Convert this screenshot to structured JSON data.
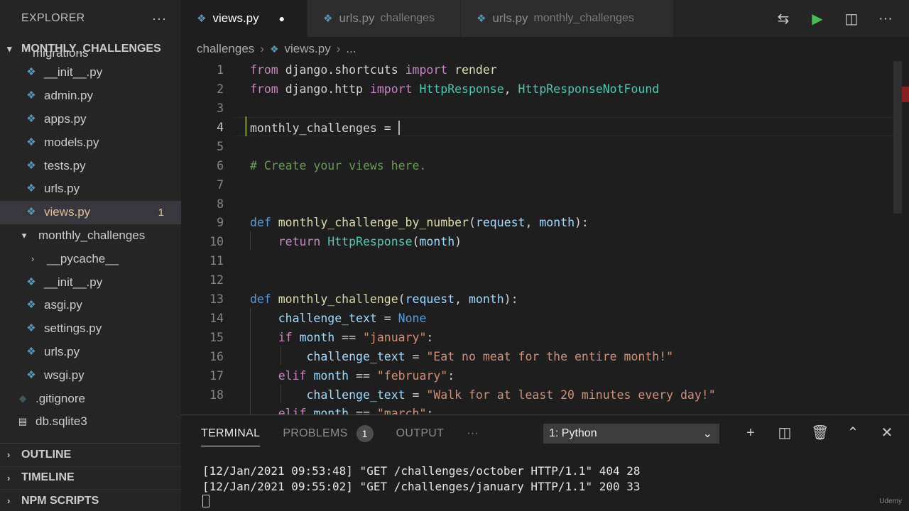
{
  "sidebar": {
    "title": "EXPLORER",
    "more": "···",
    "root": "MONTHLY_CHALLENGES",
    "items": [
      {
        "label": "migrations",
        "kind": "folder-partial"
      },
      {
        "label": "__init__.py",
        "kind": "py"
      },
      {
        "label": "admin.py",
        "kind": "py"
      },
      {
        "label": "apps.py",
        "kind": "py"
      },
      {
        "label": "models.py",
        "kind": "py"
      },
      {
        "label": "tests.py",
        "kind": "py"
      },
      {
        "label": "urls.py",
        "kind": "py"
      },
      {
        "label": "views.py",
        "kind": "py",
        "selected": true,
        "problems": "1"
      },
      {
        "label": "monthly_challenges",
        "kind": "folder-open"
      },
      {
        "label": "__pycache__",
        "kind": "folder-closed"
      },
      {
        "label": "__init__.py",
        "kind": "py"
      },
      {
        "label": "asgi.py",
        "kind": "py"
      },
      {
        "label": "settings.py",
        "kind": "py"
      },
      {
        "label": "urls.py",
        "kind": "py"
      },
      {
        "label": "wsgi.py",
        "kind": "py"
      },
      {
        "label": ".gitignore",
        "kind": "git"
      },
      {
        "label": "db.sqlite3",
        "kind": "db"
      }
    ],
    "sections": [
      "OUTLINE",
      "TIMELINE",
      "NPM SCRIPTS"
    ]
  },
  "tabs": [
    {
      "label": "views.py",
      "desc": "",
      "active": true,
      "dirty": true
    },
    {
      "label": "urls.py",
      "desc": "challenges",
      "active": false
    },
    {
      "label": "urls.py",
      "desc": "monthly_challenges",
      "active": false
    }
  ],
  "breadcrumb": {
    "folder": "challenges",
    "file": "views.py",
    "more": "..."
  },
  "editor": {
    "current_line": 4,
    "lines": [
      {
        "n": "1"
      },
      {
        "n": "2"
      },
      {
        "n": "3"
      },
      {
        "n": "4"
      },
      {
        "n": "5"
      },
      {
        "n": "6"
      },
      {
        "n": "7"
      },
      {
        "n": "8"
      },
      {
        "n": "9"
      },
      {
        "n": "10"
      },
      {
        "n": "11"
      },
      {
        "n": "12"
      },
      {
        "n": "13"
      },
      {
        "n": "14"
      },
      {
        "n": "15"
      },
      {
        "n": "16"
      },
      {
        "n": "17"
      },
      {
        "n": "18"
      }
    ],
    "tokens": {
      "l1_from": "from",
      "l1_mod": "django.shortcuts",
      "l1_import": "import",
      "l1_name": "render",
      "l2_from": "from",
      "l2_mod": "django.http",
      "l2_import": "import",
      "l2_a": "HttpResponse",
      "l2_comma": ",",
      "l2_b": "HttpResponseNotFound",
      "l4_var": "monthly_challenges",
      "l4_eq": " = ",
      "l6_comment": "# Create your views here.",
      "l9_def": "def",
      "l9_fn": "monthly_challenge_by_number",
      "l9_open": "(",
      "l9_p1": "request",
      "l9_comma": ", ",
      "l9_p2": "month",
      "l9_close": "):",
      "l10_return": "return",
      "l10_cls": "HttpResponse",
      "l10_open": "(",
      "l10_arg": "month",
      "l10_close": ")",
      "l13_def": "def",
      "l13_fn": "monthly_challenge",
      "l13_open": "(",
      "l13_p1": "request",
      "l13_comma": ", ",
      "l13_p2": "month",
      "l13_close": "):",
      "l14_var": "challenge_text",
      "l14_eq": " = ",
      "l14_none": "None",
      "l15_if": "if",
      "l15_var": "month",
      "l15_eq": " == ",
      "l15_str": "\"january\"",
      "l15_colon": ":",
      "l16_var": "challenge_text",
      "l16_eq": " = ",
      "l16_str": "\"Eat no meat for the entire month!\"",
      "l17_elif": "elif",
      "l17_var": "month",
      "l17_eq": " == ",
      "l17_str": "\"february\"",
      "l17_colon": ":",
      "l18_var": "challenge_text",
      "l18_eq": " = ",
      "l18_str": "\"Walk for at least 20 minutes every day!\"",
      "l19_elif": "elif",
      "l19_var": "month",
      "l19_eq": " == ",
      "l19_str": "\"march\"",
      "l19_colon": ":"
    }
  },
  "panel": {
    "tabs": [
      {
        "label": "TERMINAL",
        "active": true
      },
      {
        "label": "PROBLEMS",
        "badge": "1"
      },
      {
        "label": "OUTPUT"
      },
      {
        "label": "···"
      }
    ],
    "terminal_select": "1: Python",
    "terminal_lines": [
      "[12/Jan/2021 09:53:48] \"GET /challenges/october HTTP/1.1\" 404 28",
      "[12/Jan/2021 09:55:02] \"GET /challenges/january HTTP/1.1\" 200 33"
    ]
  },
  "watermark": "Udemy",
  "colors": {
    "accent_run": "#3ec150",
    "selection": "#37373d",
    "modified": "#e2c08d",
    "python_icon": "#519aba"
  },
  "icons": [
    "ellipsis-icon",
    "python-file-icon",
    "chevron-down-icon",
    "chevron-right-icon",
    "git-icon",
    "database-icon",
    "compare-changes-icon",
    "run-icon",
    "split-editor-icon",
    "plus-icon",
    "trash-icon",
    "chevron-up-icon",
    "close-icon"
  ]
}
